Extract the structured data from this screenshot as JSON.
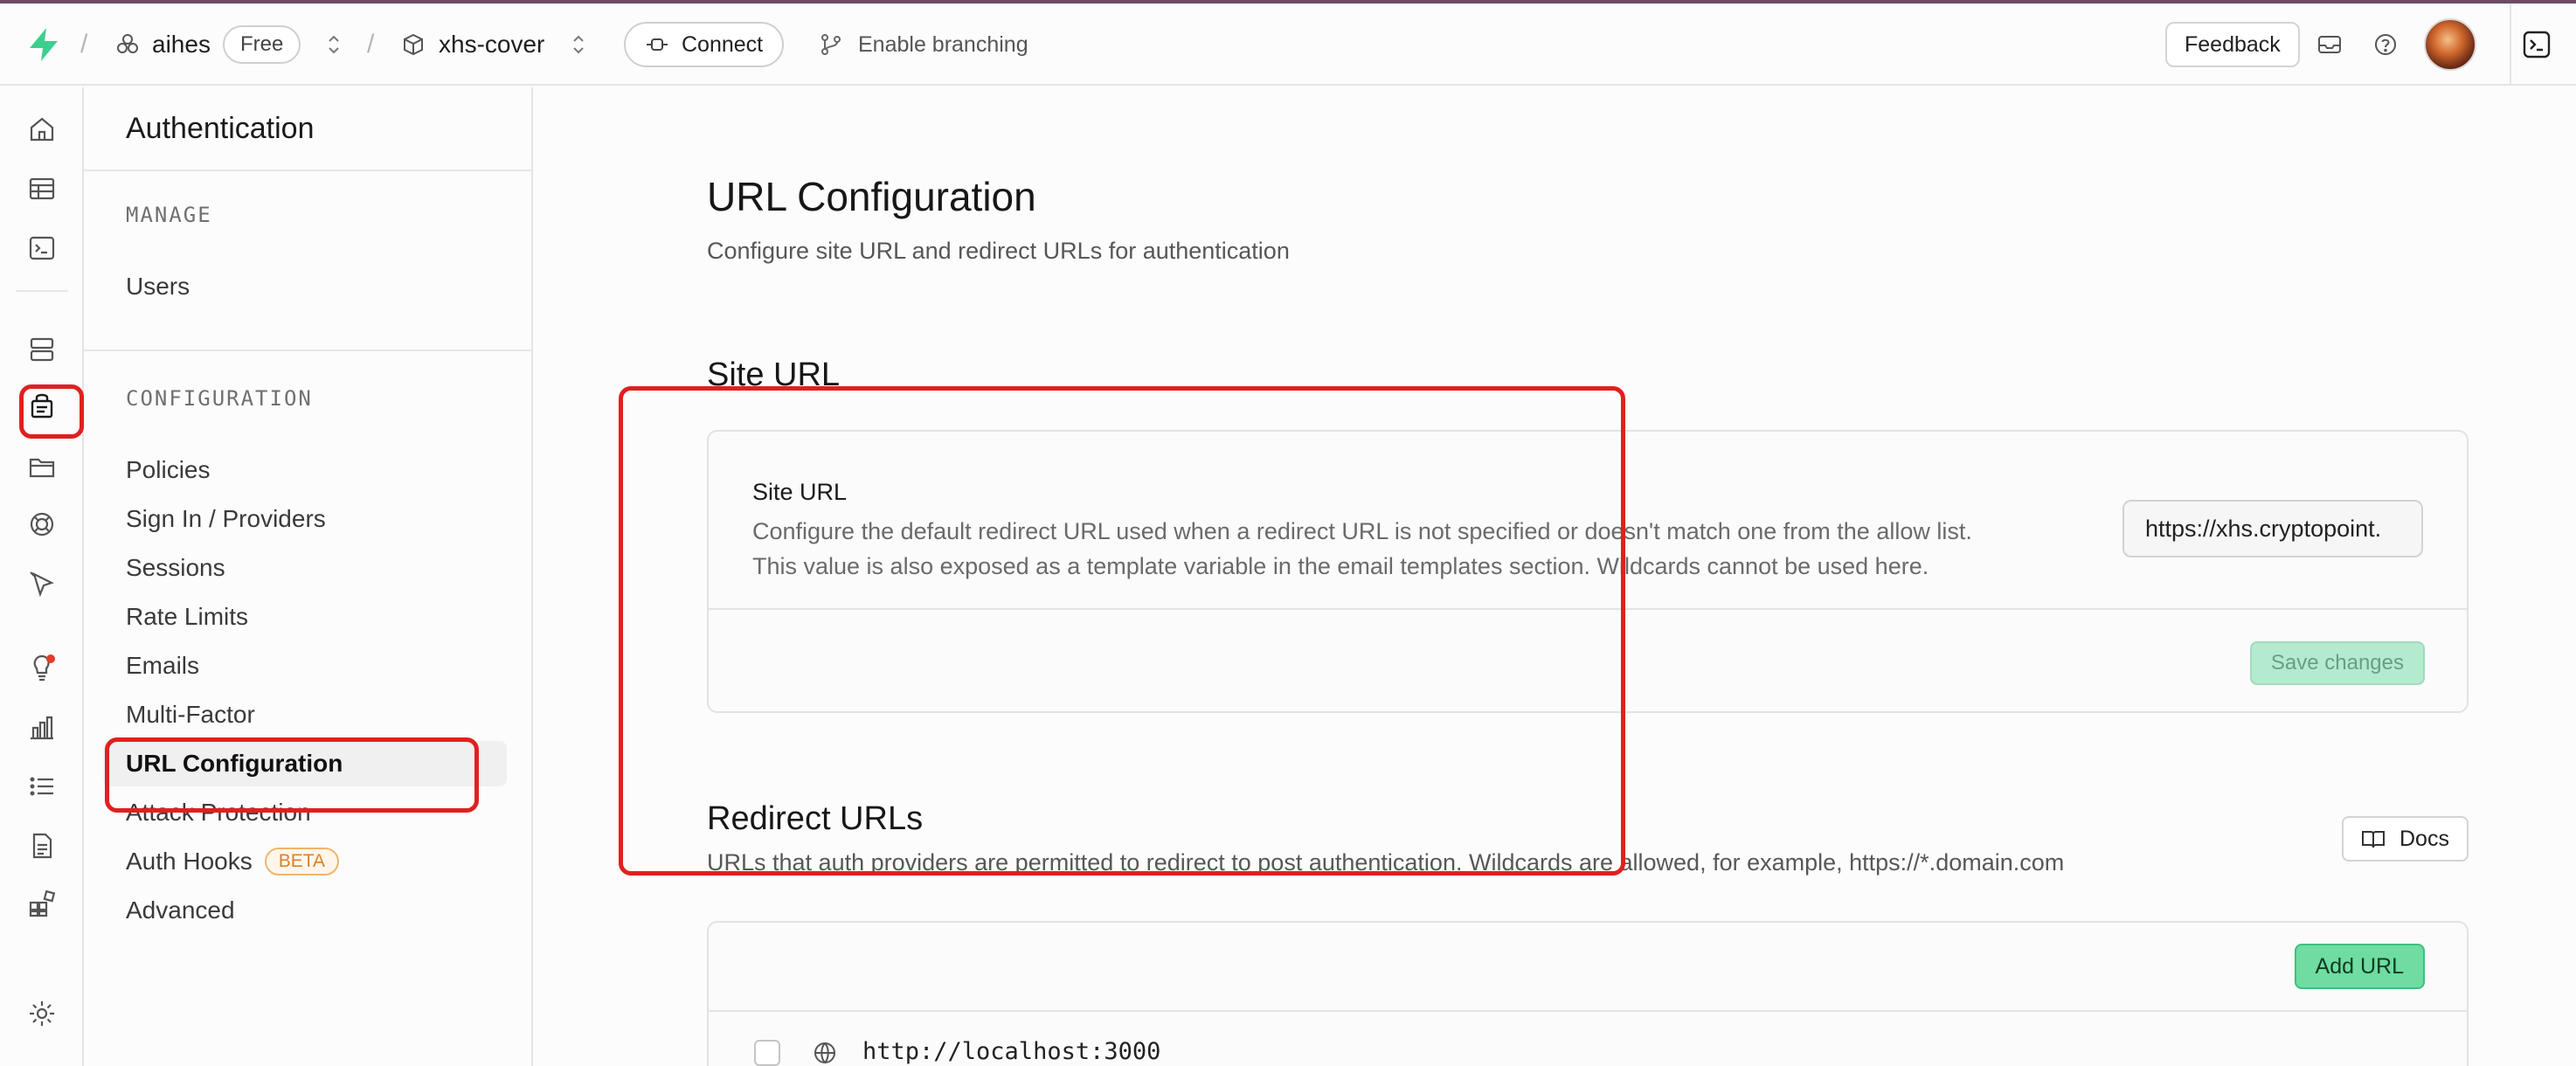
{
  "topbar": {
    "org_name": "aihes",
    "org_plan": "Free",
    "project_name": "xhs-cover",
    "connect_label": "Connect",
    "branching_label": "Enable branching",
    "feedback_label": "Feedback"
  },
  "rail": {
    "icons": [
      "home-icon",
      "table-editor-icon",
      "sql-editor-icon",
      "database-icon",
      "authentication-icon",
      "storage-icon",
      "realtime-icon",
      "edge-functions-icon",
      "advisors-icon",
      "reports-icon",
      "logs-icon",
      "api-docs-icon",
      "integrations-icon",
      "settings-icon"
    ]
  },
  "sidebar": {
    "title": "Authentication",
    "manage_heading": "MANAGE",
    "manage_items": [
      "Users"
    ],
    "config_heading": "CONFIGURATION",
    "config_items": [
      "Policies",
      "Sign In / Providers",
      "Sessions",
      "Rate Limits",
      "Emails",
      "Multi-Factor",
      "URL Configuration",
      "Attack Protection",
      "Auth Hooks",
      "Advanced"
    ],
    "active_item": "URL Configuration",
    "beta_badge": "BETA"
  },
  "main": {
    "title": "URL Configuration",
    "subtitle": "Configure site URL and redirect URLs for authentication",
    "site_url_heading": "Site URL",
    "site_url_card": {
      "label": "Site URL",
      "description_line1": "Configure the default redirect URL used when a redirect URL is not specified or doesn't match one from the allow list.",
      "description_line2": "This value is also exposed as a template variable in the email templates section. Wildcards cannot be used here.",
      "input_value": "https://xhs.cryptopoint.",
      "save_label": "Save changes"
    },
    "redirect_heading": "Redirect URLs",
    "redirect_subtitle": "URLs that auth providers are permitted to redirect to post authentication. Wildcards are allowed, for example, https://*.domain.com",
    "docs_label": "Docs",
    "add_url_label": "Add URL",
    "redirect_urls": [
      "http://localhost:3000"
    ]
  },
  "colors": {
    "brand_green": "#3ecf8e",
    "annotation_red": "#e02020"
  }
}
